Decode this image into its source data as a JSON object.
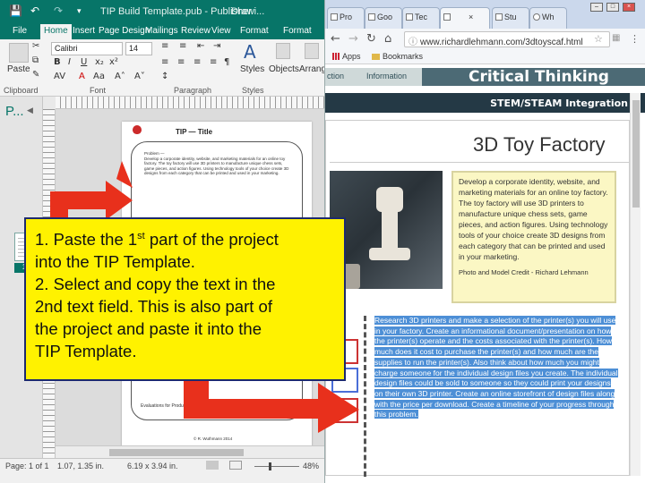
{
  "publisher": {
    "title": "TIP Build Template.pub - Publisher",
    "drawing_tab": "Drawi...",
    "tabs": [
      "File",
      "Home",
      "Insert",
      "Page Design",
      "Mailings",
      "Review",
      "View",
      "Format",
      "Format"
    ],
    "active_tab": "Home",
    "font_name": "Calibri",
    "font_size": "14",
    "ribbon_buttons": {
      "paste": "Paste",
      "styles": "Styles",
      "objects": "Objects",
      "arrange": "Arrang..."
    },
    "group_labels": {
      "clipboard": "Clipboard",
      "font": "Font",
      "paragraph": "Paragraph",
      "styles": "Styles"
    },
    "pages_pane_label": "P...",
    "page_number": "1",
    "document": {
      "tip_title": "TIP   — Title",
      "problem_heading": "Problem —",
      "problem_text": "Develop a corporate identity, website, and marketing materials for an online toy factory. The toy factory will use 3D printers to manufacture unique chess sets, game pieces, and action figures. Using technology tools of your choice create 3D designs from each category that can be printed and used in your marketing.",
      "evaluations": "Evaluations for Product ...ns",
      "footer": "© R. Wuthmann 2014"
    },
    "status": {
      "page": "Page: 1 of 1",
      "position": "1.07, 1.35 in.",
      "size": "6.19 x 3.94 in.",
      "zoom": "48%"
    }
  },
  "browser": {
    "tabs": [
      {
        "label": "Pro",
        "active": false
      },
      {
        "label": "Goo",
        "active": false
      },
      {
        "label": "Tec",
        "active": false
      },
      {
        "label": "",
        "active": true
      },
      {
        "label": "Stu",
        "active": false
      },
      {
        "label": "Wh",
        "active": false
      }
    ],
    "url": "www.richardlehmann.com/3dtoyscaf.html",
    "bookmarks": [
      "Apps",
      "Bookmarks"
    ],
    "site": {
      "nav_items": [
        "ction",
        "Information"
      ],
      "header_title": "Critical Thinking",
      "subheader": "STEM/STEAM Integration",
      "page_title": "3D Toy Factory",
      "description": "Develop a corporate identity, website, and marketing materials for an online toy factory. The toy factory will use 3D printers to manufacture unique chess sets, game pieces, and action figures. Using technology tools of your choice create 3D designs from each category that can be printed and used in your marketing.",
      "credit": "Photo and Model Credit - Richard Lehmann",
      "selected_text": "Research 3D printers and make a selection of the printer(s) you will use in your factory. Create an informational document/presentation on how the printer(s) operate and the costs associated with the printer(s). How much does it cost to purchase the printer(s) and how much are the supplies to run the printer(s). Also think about how much you might charge someone for the individual design files you create. The individual design files could be sold to someone so they could print your designs on their own 3D printer. Create an online storefront of design files along with the price per download. Create a timeline of your progress through this problem."
    }
  },
  "callout": {
    "line1_pre": "1. Paste the 1",
    "line1_sup": "st",
    "line1_post": " part of the project",
    "line2": "into the TIP Template.",
    "line3": "2. Select and copy the text in the",
    "line4": "2nd text field. This is also part of",
    "line5": "the project and paste it into the",
    "line6": "TIP Template."
  },
  "colors": {
    "publisher_accent": "#077568",
    "arrow": "#e8301c",
    "callout_fill": "#fff200",
    "callout_border": "#1d2a6e",
    "selection": "#4d8fd6",
    "site_header": "#4c6a75",
    "site_subheader": "#243945"
  }
}
